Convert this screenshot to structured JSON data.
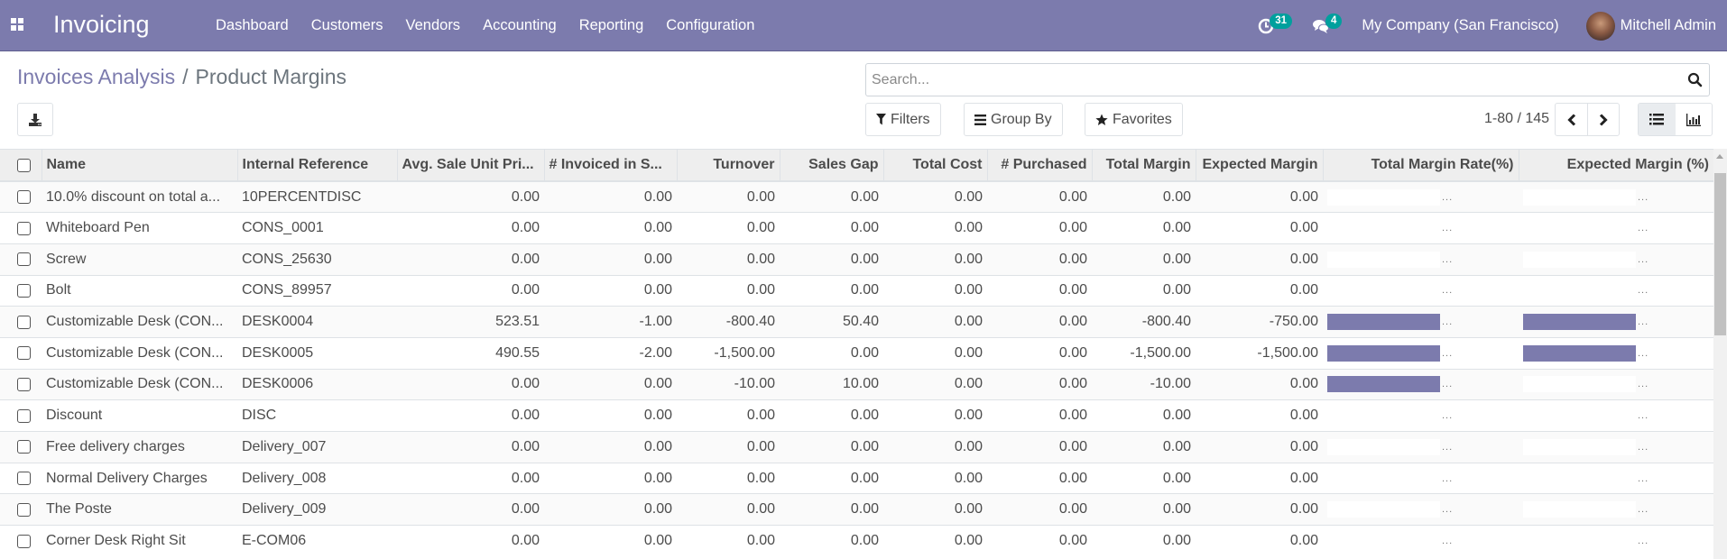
{
  "navbar": {
    "app_name": "Invoicing",
    "menu": [
      "Dashboard",
      "Customers",
      "Vendors",
      "Accounting",
      "Reporting",
      "Configuration"
    ],
    "activity_count": "31",
    "message_count": "4",
    "company": "My Company (San Francisco)",
    "user": "Mitchell Admin",
    "brand_color": "#7c7bad",
    "badge_color": "#00a09d"
  },
  "breadcrumb": {
    "parent": "Invoices Analysis",
    "separator": "/",
    "current": "Product Margins"
  },
  "search": {
    "placeholder": "Search...",
    "value": ""
  },
  "buttons": {
    "filters": "Filters",
    "group_by": "Group By",
    "favorites": "Favorites"
  },
  "pager": {
    "value": "1-80 / 145"
  },
  "views": {
    "active": "list",
    "options": [
      "list",
      "graph"
    ]
  },
  "table": {
    "columns": [
      "Name",
      "Internal Reference",
      "Avg. Sale Unit Pri...",
      "# Invoiced in S...",
      "Turnover",
      "Sales Gap",
      "Total Cost",
      "# Purchased",
      "Total Margin",
      "Expected Margin",
      "Total Margin Rate(%)",
      "Expected Margin (%)"
    ],
    "rows": [
      {
        "name": "10.0% discount on total a...",
        "ref": "10PERCENTDISC",
        "avg_price": "0.00",
        "invoiced": "0.00",
        "turnover": "0.00",
        "sales_gap": "0.00",
        "total_cost": "0.00",
        "purchased": "0.00",
        "total_margin": "0.00",
        "expected_margin": "0.00",
        "margin_rate": 0,
        "margin_rate_label": "...",
        "expected_rate": 0,
        "expected_rate_label": "..."
      },
      {
        "name": "Whiteboard Pen",
        "ref": "CONS_0001",
        "avg_price": "0.00",
        "invoiced": "0.00",
        "turnover": "0.00",
        "sales_gap": "0.00",
        "total_cost": "0.00",
        "purchased": "0.00",
        "total_margin": "0.00",
        "expected_margin": "0.00",
        "margin_rate": 0,
        "margin_rate_label": "...",
        "expected_rate": 0,
        "expected_rate_label": "..."
      },
      {
        "name": "Screw",
        "ref": "CONS_25630",
        "avg_price": "0.00",
        "invoiced": "0.00",
        "turnover": "0.00",
        "sales_gap": "0.00",
        "total_cost": "0.00",
        "purchased": "0.00",
        "total_margin": "0.00",
        "expected_margin": "0.00",
        "margin_rate": 0,
        "margin_rate_label": "...",
        "expected_rate": 0,
        "expected_rate_label": "..."
      },
      {
        "name": "Bolt",
        "ref": "CONS_89957",
        "avg_price": "0.00",
        "invoiced": "0.00",
        "turnover": "0.00",
        "sales_gap": "0.00",
        "total_cost": "0.00",
        "purchased": "0.00",
        "total_margin": "0.00",
        "expected_margin": "0.00",
        "margin_rate": 0,
        "margin_rate_label": "...",
        "expected_rate": 0,
        "expected_rate_label": "..."
      },
      {
        "name": "Customizable Desk (CON...",
        "ref": "DESK0004",
        "avg_price": "523.51",
        "invoiced": "-1.00",
        "turnover": "-800.40",
        "sales_gap": "50.40",
        "total_cost": "0.00",
        "purchased": "0.00",
        "total_margin": "-800.40",
        "expected_margin": "-750.00",
        "margin_rate": 100,
        "margin_rate_label": "...",
        "expected_rate": 100,
        "expected_rate_label": "..."
      },
      {
        "name": "Customizable Desk (CON...",
        "ref": "DESK0005",
        "avg_price": "490.55",
        "invoiced": "-2.00",
        "turnover": "-1,500.00",
        "sales_gap": "0.00",
        "total_cost": "0.00",
        "purchased": "0.00",
        "total_margin": "-1,500.00",
        "expected_margin": "-1,500.00",
        "margin_rate": 100,
        "margin_rate_label": "...",
        "expected_rate": 100,
        "expected_rate_label": "..."
      },
      {
        "name": "Customizable Desk (CON...",
        "ref": "DESK0006",
        "avg_price": "0.00",
        "invoiced": "0.00",
        "turnover": "-10.00",
        "sales_gap": "10.00",
        "total_cost": "0.00",
        "purchased": "0.00",
        "total_margin": "-10.00",
        "expected_margin": "0.00",
        "margin_rate": 100,
        "margin_rate_label": "...",
        "expected_rate": 0,
        "expected_rate_label": "..."
      },
      {
        "name": "Discount",
        "ref": "DISC",
        "avg_price": "0.00",
        "invoiced": "0.00",
        "turnover": "0.00",
        "sales_gap": "0.00",
        "total_cost": "0.00",
        "purchased": "0.00",
        "total_margin": "0.00",
        "expected_margin": "0.00",
        "margin_rate": 0,
        "margin_rate_label": "...",
        "expected_rate": 0,
        "expected_rate_label": "..."
      },
      {
        "name": "Free delivery charges",
        "ref": "Delivery_007",
        "avg_price": "0.00",
        "invoiced": "0.00",
        "turnover": "0.00",
        "sales_gap": "0.00",
        "total_cost": "0.00",
        "purchased": "0.00",
        "total_margin": "0.00",
        "expected_margin": "0.00",
        "margin_rate": 0,
        "margin_rate_label": "...",
        "expected_rate": 0,
        "expected_rate_label": "..."
      },
      {
        "name": "Normal Delivery Charges",
        "ref": "Delivery_008",
        "avg_price": "0.00",
        "invoiced": "0.00",
        "turnover": "0.00",
        "sales_gap": "0.00",
        "total_cost": "0.00",
        "purchased": "0.00",
        "total_margin": "0.00",
        "expected_margin": "0.00",
        "margin_rate": 0,
        "margin_rate_label": "...",
        "expected_rate": 0,
        "expected_rate_label": "..."
      },
      {
        "name": "The Poste",
        "ref": "Delivery_009",
        "avg_price": "0.00",
        "invoiced": "0.00",
        "turnover": "0.00",
        "sales_gap": "0.00",
        "total_cost": "0.00",
        "purchased": "0.00",
        "total_margin": "0.00",
        "expected_margin": "0.00",
        "margin_rate": 0,
        "margin_rate_label": "...",
        "expected_rate": 0,
        "expected_rate_label": "..."
      },
      {
        "name": "Corner Desk Right Sit",
        "ref": "E-COM06",
        "avg_price": "0.00",
        "invoiced": "0.00",
        "turnover": "0.00",
        "sales_gap": "0.00",
        "total_cost": "0.00",
        "purchased": "0.00",
        "total_margin": "0.00",
        "expected_margin": "0.00",
        "margin_rate": 0,
        "margin_rate_label": "...",
        "expected_rate": 0,
        "expected_rate_label": "..."
      }
    ]
  }
}
